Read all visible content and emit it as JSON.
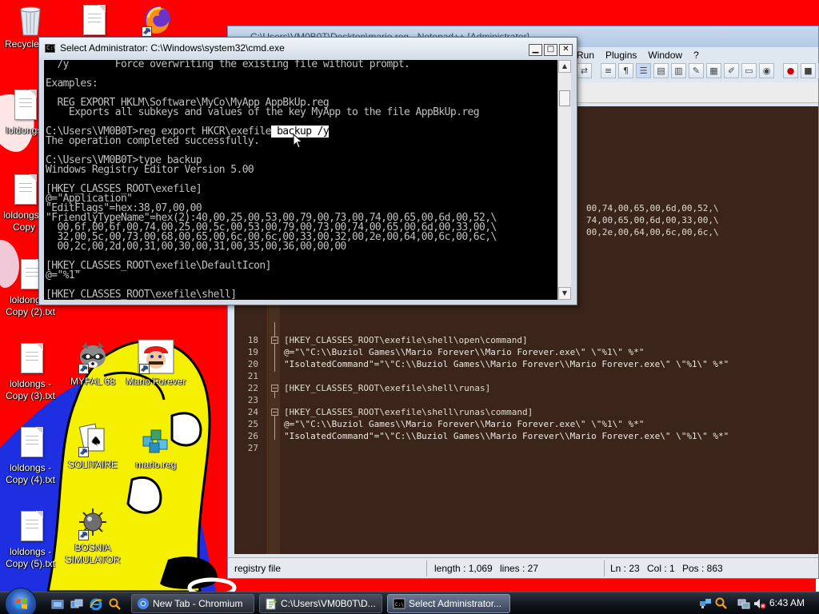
{
  "desktop": {
    "icons": [
      {
        "label": "Recycle Bin"
      },
      {
        "label": "loldongs"
      },
      {
        "label": "loldongs - Copy"
      },
      {
        "label": "loldongs - Copy (2).txt"
      },
      {
        "label": "loldongs - Copy (3).txt"
      },
      {
        "label": "loldongs - Copy (4).txt"
      },
      {
        "label": "loldongs - Copy (5).txt"
      },
      {
        "label": "MYPAL 68"
      },
      {
        "label": "Mario Forever"
      },
      {
        "label": "SOLITAIRE"
      },
      {
        "label": "mario.reg"
      },
      {
        "label": "BOSNIA SIMULATOR"
      }
    ]
  },
  "cmd": {
    "title": "Select Administrator: C:\\Windows\\system32\\cmd.exe",
    "lines": [
      "  /y        Force overwriting the existing file without prompt.",
      "",
      "Examples:",
      "",
      "  REG EXPORT HKLM\\Software\\MyCo\\MyApp AppBkUp.reg",
      "    Exports all subkeys and values of the key MyApp to the file AppBkUp.reg",
      "",
      "C:\\Users\\VM0B0T>reg export HKCR\\exefile",
      "The operation completed successfully.",
      "",
      "C:\\Users\\VM0B0T>type backup",
      "Windows Registry Editor Version 5.00",
      "",
      "[HKEY_CLASSES_ROOT\\exefile]",
      "@=\"Application\"",
      "\"EditFlags\"=hex:38,07,00,00",
      "\"FriendlyTypeName\"=hex(2):40,00,25,00,53,00,79,00,73,00,74,00,65,00,6d,00,52,\\",
      "  00,6f,00,6f,00,74,00,25,00,5c,00,53,00,79,00,73,00,74,00,65,00,6d,00,33,00,\\",
      "  32,00,5c,00,73,00,68,00,65,00,6c,00,6c,00,33,00,32,00,2e,00,64,00,6c,00,6c,\\",
      "  00,2c,00,2d,00,31,00,30,00,31,00,35,00,36,00,00,00",
      "",
      "[HKEY_CLASSES_ROOT\\exefile\\DefaultIcon]",
      "@=\"%1\"",
      "",
      "[HKEY_CLASSES_ROOT\\exefile\\shell]"
    ],
    "selected_text": " backup /y"
  },
  "notepad": {
    "title": "C:\\Users\\VM0B0T\\Desktop\\mario.reg - Notepad++ [Administrator]",
    "menus": [
      "Run",
      "Plugins",
      "Window",
      "?"
    ],
    "partial_lines": [
      "00,74,00,65,00,6d,00,52,\\",
      "74,00,65,00,6d,00,33,00,\\",
      "00,2e,00,64,00,6c,00,6c,\\"
    ],
    "lines": [
      {
        "num": "18",
        "text": "[HKEY_CLASSES_ROOT\\exefile\\shell\\open\\command]"
      },
      {
        "num": "19",
        "text": "@=\"\\\"C:\\\\Buziol Games\\\\Mario Forever\\\\Mario Forever.exe\\\" \\\"%1\\\" %*\""
      },
      {
        "num": "20",
        "text": "\"IsolatedCommand\"=\"\\\"C:\\\\Buziol Games\\\\Mario Forever\\\\Mario Forever.exe\\\" \\\"%1\\\" %*\""
      },
      {
        "num": "21",
        "text": ""
      },
      {
        "num": "22",
        "text": "[HKEY_CLASSES_ROOT\\exefile\\shell\\runas]"
      },
      {
        "num": "23",
        "text": ""
      },
      {
        "num": "24",
        "text": "[HKEY_CLASSES_ROOT\\exefile\\shell\\runas\\command]"
      },
      {
        "num": "25",
        "text": "@=\"\\\"C:\\\\Buziol Games\\\\Mario Forever\\\\Mario Forever.exe\\\" \\\"%1\\\" %*\""
      },
      {
        "num": "26",
        "text": "\"IsolatedCommand\"=\"\\\"C:\\\\Buziol Games\\\\Mario Forever\\\\Mario Forever.exe\\\" \\\"%1\\\" %*\""
      },
      {
        "num": "27",
        "text": ""
      }
    ],
    "status": {
      "filetype": "registry file",
      "length": "length : 1,069",
      "lines": "lines : 27",
      "ln": "Ln : 23",
      "col": "Col : 1",
      "pos": "Pos : 863"
    }
  },
  "taskbar": {
    "buttons": [
      {
        "label": "New Tab - Chromium"
      },
      {
        "label": "C:\\Users\\VM0B0T\\D..."
      },
      {
        "label": "Select Administrator..."
      }
    ],
    "clock": "6:43 AM"
  },
  "colors": {
    "wallpaper_red": "#ff0000",
    "editor_bg": "#3b2419",
    "cmd_bg": "#000000",
    "cmd_text": "#c0c0c0"
  }
}
